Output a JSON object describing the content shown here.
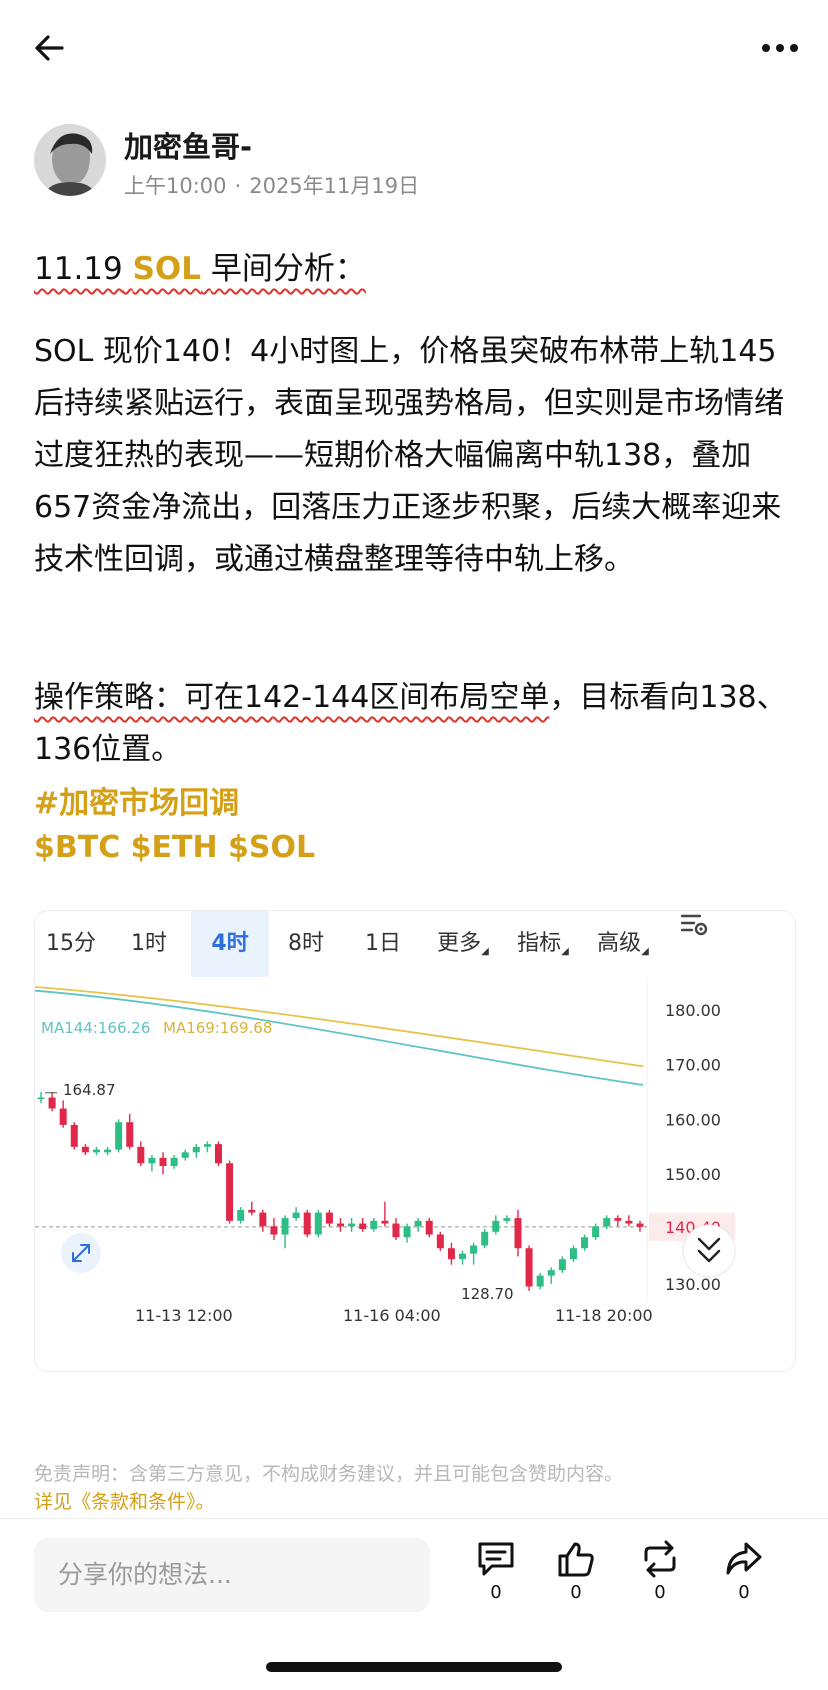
{
  "post": {
    "author": "加密鱼哥-",
    "time": "上午10:00",
    "date": "2025年11月19日",
    "dot": "·",
    "title_prefix": "11.19",
    "title_sol": "SOL",
    "title_suffix": "早间分析：",
    "body": "SOL 现价140！4小时图上，价格虽突破布林带上轨145后持续紧贴运行，表面呈现强势格局，但实则是市场情绪过度狂热的表现——短期价格大幅偏离中轨138，叠加657资金净流出，回落压力正逐步积聚，后续大概率迎来技术性回调，或通过横盘整理等待中轨上移。",
    "strategy_underlined": "操作策略：可在142-144区间布局空单",
    "strategy_rest": "，目标看向138、136位置。",
    "hashtag": "#加密市场回调",
    "tickers": "$BTC $ETH $SOL"
  },
  "chart_widget": {
    "tabs": [
      "15分",
      "1时",
      "4时",
      "8时",
      "1日",
      "更多",
      "指标",
      "高级"
    ],
    "active_tab": "4时",
    "settings_icon": "chart-settings-icon",
    "expand_icon": "expand-icon",
    "scroll_down_icon": "double-chevron-down-icon",
    "ma144_label": "MA144:166.26",
    "ma169_label": "MA169:169.68",
    "high_label": "164.87",
    "low_label": "128.70",
    "current_price_label": "140.40",
    "colors": {
      "up": "#2ebd85",
      "down": "#e0294a",
      "ma144": "#5fc4c4",
      "ma169": "#e8c34a",
      "accent": "#2f6fdc"
    }
  },
  "chart_data": {
    "type": "candlestick",
    "y_ticks": [
      "180.00",
      "170.00",
      "160.00",
      "150.00",
      "140.40",
      "130.00"
    ],
    "x_ticks": [
      "11-13 12:00",
      "11-16 04:00",
      "11-18 20:00"
    ],
    "ylim": [
      126.5,
      186
    ],
    "candles": [
      [
        164,
        165,
        163,
        164
      ],
      [
        164,
        165,
        161.5,
        162
      ],
      [
        162,
        163.5,
        158.5,
        159
      ],
      [
        159,
        159.5,
        154.5,
        155
      ],
      [
        155,
        155.5,
        153.5,
        154
      ],
      [
        154,
        155,
        153.5,
        154.5
      ],
      [
        154,
        155,
        153.5,
        154.5
      ],
      [
        154.5,
        160,
        154,
        159.5
      ],
      [
        159.5,
        161,
        154.5,
        155
      ],
      [
        155,
        156,
        151.5,
        152
      ],
      [
        152,
        153.5,
        150.5,
        153
      ],
      [
        153,
        154,
        150,
        151.5
      ],
      [
        151.5,
        153.5,
        151,
        153
      ],
      [
        153,
        154.5,
        152.5,
        154
      ],
      [
        154,
        155.5,
        153,
        155
      ],
      [
        155,
        156,
        154,
        155.5
      ],
      [
        155.5,
        156,
        151.5,
        152
      ],
      [
        152,
        152.5,
        141,
        141.5
      ],
      [
        141.5,
        144,
        141,
        143.5
      ],
      [
        143.5,
        145,
        142.5,
        143
      ],
      [
        143,
        143.5,
        139.5,
        140.5
      ],
      [
        140.5,
        142,
        138,
        139
      ],
      [
        139,
        142.5,
        136.5,
        142
      ],
      [
        142,
        144,
        141.5,
        143
      ],
      [
        143,
        143.5,
        138.5,
        139
      ],
      [
        139,
        143.5,
        138.5,
        143
      ],
      [
        143,
        143.5,
        140.5,
        141
      ],
      [
        141,
        142,
        139.5,
        140.5
      ],
      [
        140.5,
        142,
        139.5,
        141
      ],
      [
        141,
        142,
        139.5,
        140
      ],
      [
        140,
        142,
        139.5,
        141.5
      ],
      [
        141.5,
        145,
        140.5,
        141
      ],
      [
        141,
        142,
        138,
        138.5
      ],
      [
        138.5,
        141,
        137.5,
        140.5
      ],
      [
        140.5,
        142,
        139.5,
        141.5
      ],
      [
        141.5,
        142,
        138.5,
        139
      ],
      [
        139,
        139.5,
        136,
        136.5
      ],
      [
        136.5,
        137.5,
        133.5,
        134.5
      ],
      [
        134.5,
        136,
        133.5,
        135.5
      ],
      [
        135.5,
        137.5,
        133.5,
        137
      ],
      [
        137,
        140,
        136.5,
        139.5
      ],
      [
        139.5,
        142.5,
        139,
        141.5
      ],
      [
        141.5,
        142.5,
        141,
        142
      ],
      [
        142,
        143.5,
        135,
        136.5
      ],
      [
        136.5,
        137,
        128.7,
        129.5
      ],
      [
        129.5,
        132,
        129,
        131.5
      ],
      [
        131.5,
        133,
        130,
        132.5
      ],
      [
        132.5,
        135,
        132,
        134.5
      ],
      [
        134.5,
        137,
        134,
        136.5
      ],
      [
        136.5,
        139,
        136,
        138.5
      ],
      [
        138.5,
        141,
        138,
        140.5
      ],
      [
        140.5,
        142.5,
        140,
        142
      ],
      [
        142,
        142.5,
        140.5,
        141.5
      ],
      [
        141.5,
        142.5,
        140.5,
        141
      ],
      [
        141,
        141.5,
        139.5,
        140.4
      ]
    ],
    "ma144": [
      183.5,
      166.3
    ],
    "ma169": [
      184.2,
      169.7
    ]
  },
  "actions": {
    "comment_count": "0",
    "like_count": "0",
    "repost_count": "0",
    "share_count": "0"
  },
  "disclaimer": {
    "text": "免责声明：含第三方意见，不构成财务建议，并且可能包含赞助内容。",
    "link": "详见《条款和条件》。"
  },
  "input": {
    "placeholder": "分享你的想法..."
  }
}
